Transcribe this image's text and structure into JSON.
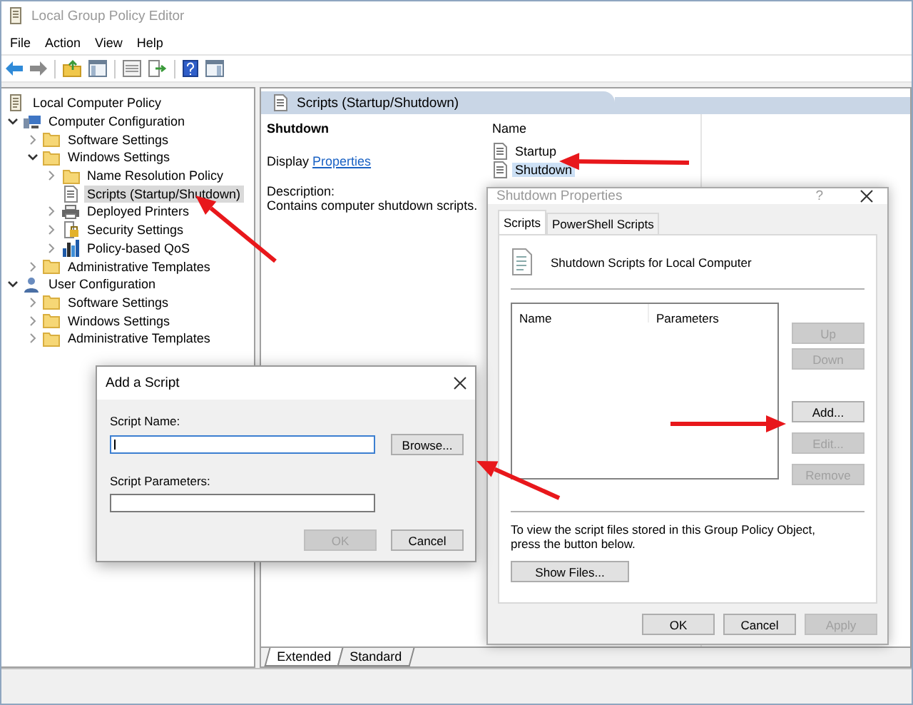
{
  "window": {
    "title": "Local Group Policy Editor"
  },
  "menu": [
    "File",
    "Action",
    "View",
    "Help"
  ],
  "tree": [
    {
      "label": "Local Computer Policy",
      "kind": "policy",
      "selected": false,
      "children": [
        {
          "label": "Computer Configuration",
          "kind": "computer",
          "expanded": true,
          "selected": false,
          "children": [
            {
              "label": "Software Settings",
              "kind": "folder",
              "expanded": false,
              "selected": false
            },
            {
              "label": "Windows Settings",
              "kind": "folder",
              "expanded": true,
              "selected": false,
              "children": [
                {
                  "label": "Name Resolution Policy",
                  "kind": "folder",
                  "expanded": false,
                  "selected": false
                },
                {
                  "label": "Scripts (Startup/Shutdown)",
                  "kind": "scripts",
                  "selected": true
                },
                {
                  "label": "Deployed Printers",
                  "kind": "printer",
                  "expanded": false,
                  "selected": false
                },
                {
                  "label": "Security Settings",
                  "kind": "security",
                  "expanded": false,
                  "selected": false
                },
                {
                  "label": "Policy-based QoS",
                  "kind": "qos",
                  "expanded": false,
                  "selected": false
                }
              ]
            },
            {
              "label": "Administrative Templates",
              "kind": "folder",
              "expanded": false,
              "selected": false
            }
          ]
        },
        {
          "label": "User Configuration",
          "kind": "user",
          "expanded": true,
          "selected": false,
          "children": [
            {
              "label": "Software Settings",
              "kind": "folder",
              "expanded": false,
              "selected": false
            },
            {
              "label": "Windows Settings",
              "kind": "folder",
              "expanded": false,
              "selected": false
            },
            {
              "label": "Administrative Templates",
              "kind": "folder",
              "expanded": false,
              "selected": false
            }
          ]
        }
      ]
    }
  ],
  "details": {
    "header": "Scripts (Startup/Shutdown)",
    "title": "Shutdown",
    "display_prefix": "Display",
    "link": "Properties",
    "description_label": "Description:",
    "description": "Contains computer shutdown scripts.",
    "column": "Name",
    "items": [
      {
        "label": "Startup",
        "selected": false
      },
      {
        "label": "Shutdown",
        "selected": true
      }
    ],
    "view_tabs": [
      {
        "label": "Extended",
        "selected": true
      },
      {
        "label": "Standard",
        "selected": false
      }
    ]
  },
  "properties_dialog": {
    "title": "Shutdown Properties",
    "help": "?",
    "tabs": [
      {
        "label": "Scripts",
        "selected": true
      },
      {
        "label": "PowerShell Scripts",
        "selected": false
      }
    ],
    "heading": "Shutdown Scripts for Local Computer",
    "columns": [
      "Name",
      "Parameters"
    ],
    "side_buttons": [
      {
        "label": "Up",
        "disabled": true
      },
      {
        "label": "Down",
        "disabled": true
      },
      {
        "label": "Add...",
        "disabled": false
      },
      {
        "label": "Edit...",
        "disabled": true
      },
      {
        "label": "Remove",
        "disabled": true
      }
    ],
    "note": "To view the script files stored in this Group Policy Object, press the button below.",
    "show_files": "Show Files...",
    "buttons": [
      {
        "label": "OK",
        "disabled": false
      },
      {
        "label": "Cancel",
        "disabled": false
      },
      {
        "label": "Apply",
        "disabled": true
      }
    ]
  },
  "add_dialog": {
    "title": "Add a Script",
    "fields": [
      {
        "label": "Script Name:",
        "focused": true
      },
      {
        "label": "Script Parameters:",
        "focused": false
      }
    ],
    "browse": "Browse...",
    "buttons": [
      {
        "label": "OK",
        "disabled": true
      },
      {
        "label": "Cancel",
        "disabled": false
      }
    ]
  }
}
